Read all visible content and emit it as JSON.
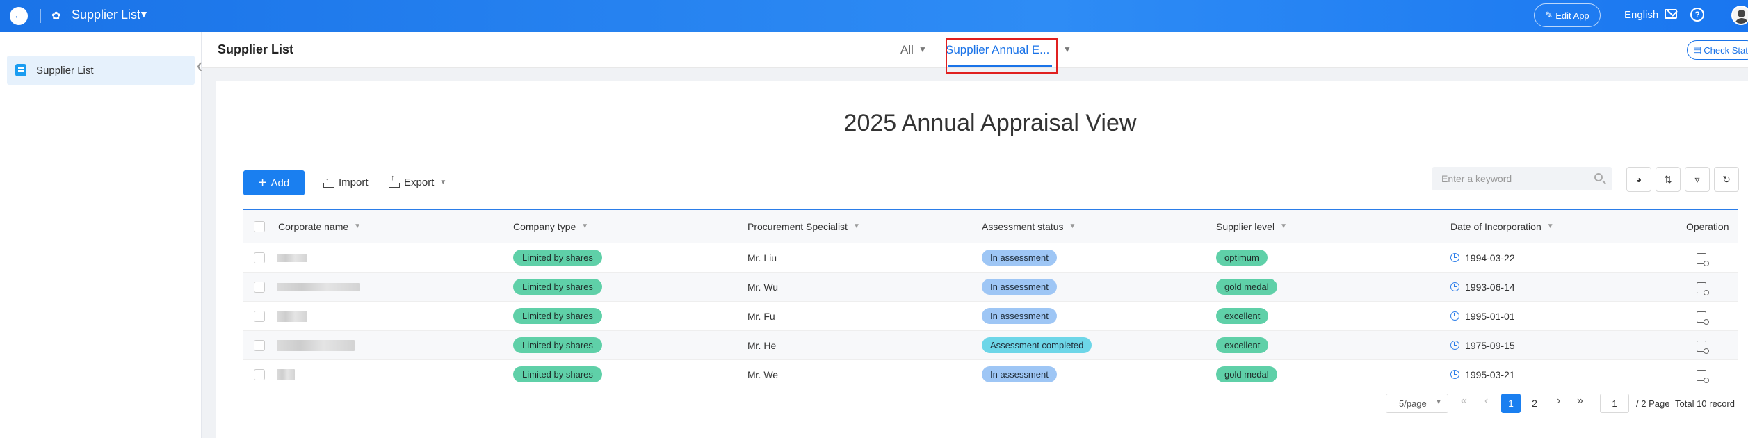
{
  "topbar": {
    "app_title": "Supplier List",
    "edit_app": "Edit App",
    "language": "English"
  },
  "sidebar": {
    "items": [
      {
        "label": "Supplier List"
      }
    ]
  },
  "header": {
    "page_title": "Supplier List",
    "tabs": [
      {
        "label": "All"
      },
      {
        "label": "Supplier Annual E..."
      }
    ],
    "check_stats": "Check Statis"
  },
  "view": {
    "title": "2025 Annual Appraisal View"
  },
  "toolbar": {
    "add_label": "Add",
    "import_label": "Import",
    "export_label": "Export",
    "search_placeholder": "Enter a keyword"
  },
  "table": {
    "columns": [
      "Corporate name",
      "Company type",
      "Procurement Specialist",
      "Assessment status",
      "Supplier level",
      "Date of Incorporation",
      "Operation"
    ],
    "rows": [
      {
        "company_type": "Limited by shares",
        "specialist": "Mr. Liu",
        "status": "In assessment",
        "level": "optimum",
        "date": "1994-03-22"
      },
      {
        "company_type": "Limited by shares",
        "specialist": "Mr. Wu",
        "status": "In assessment",
        "level": "gold medal",
        "date": "1993-06-14"
      },
      {
        "company_type": "Limited by shares",
        "specialist": "Mr. Fu",
        "status": "In assessment",
        "level": "excellent",
        "date": "1995-01-01"
      },
      {
        "company_type": "Limited by shares",
        "specialist": "Mr. He",
        "status": "Assessment completed",
        "level": "excellent",
        "date": "1975-09-15"
      },
      {
        "company_type": "Limited by shares",
        "specialist": "Mr. We",
        "status": "In assessment",
        "level": "gold medal",
        "date": "1995-03-21"
      }
    ]
  },
  "pagination": {
    "page_size": "5/page",
    "pages": [
      "1",
      "2"
    ],
    "current_page": "1",
    "total_pages_text": "/ 2 Page",
    "total_records": "Total 10 record"
  },
  "colors": {
    "accent": "#1a7ff0",
    "tag_green": "#5fd0a8",
    "tag_blue": "#9ec6f5",
    "tag_teal": "#6dd6e8",
    "highlight_box": "#e02020"
  }
}
